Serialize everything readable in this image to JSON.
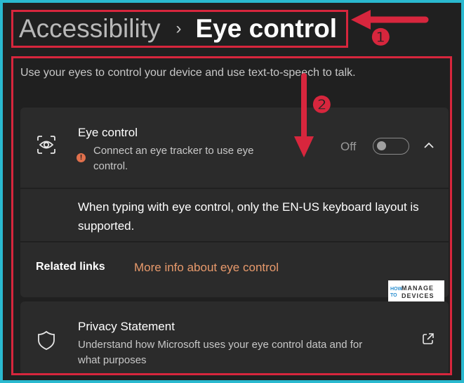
{
  "breadcrumb": {
    "parent": "Accessibility",
    "separator": "›",
    "current": "Eye control"
  },
  "description": "Use your eyes to control your device and use text-to-speech to talk.",
  "eye_control": {
    "icon": "eye-scan-icon",
    "title": "Eye control",
    "warning_icon": "info-warning-icon",
    "warning_glyph": "!",
    "warning_line1": "Connect an eye tracker to use eye",
    "warning_line2": "control.",
    "toggle_label": "Off",
    "toggle_state": false,
    "expand_icon": "chevron-up-icon"
  },
  "note": "When typing with eye control, only the EN-US keyboard layout is supported.",
  "related_links": {
    "label": "Related links",
    "link": "More info about eye control"
  },
  "privacy": {
    "icon": "shield-icon",
    "title": "Privacy Statement",
    "line1": "Understand how Microsoft uses your eye control data and for",
    "line2": "what purposes",
    "action_icon": "open-external-icon"
  },
  "watermark": {
    "prefix": "HOW TO",
    "line1": "MANAGE",
    "line2": "DEVICES"
  },
  "annotations": {
    "badge1": "❶",
    "badge2": "❷",
    "accent_color": "#d7263d"
  },
  "colors": {
    "background": "#202020",
    "card": "#2b2b2b",
    "link": "#e89a6c",
    "frame": "#2ab9cf"
  }
}
